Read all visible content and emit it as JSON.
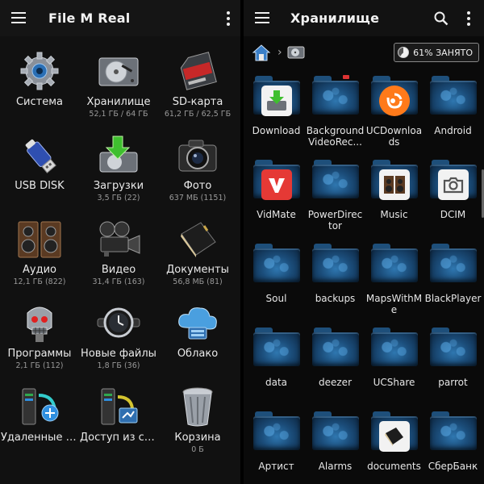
{
  "left": {
    "title": "File M Real",
    "items": [
      {
        "label": "Система",
        "sub": "",
        "icon": "gear-icon"
      },
      {
        "label": "Хранилище",
        "sub": "52,1 ГБ / 64 ГБ",
        "icon": "hard-drive-icon"
      },
      {
        "label": "SD-карта",
        "sub": "61,2 ГБ / 62,5 ГБ",
        "icon": "sd-card-icon"
      },
      {
        "label": "USB DISK",
        "sub": "",
        "icon": "usb-icon"
      },
      {
        "label": "Загрузки",
        "sub": "3,5 ГБ (22)",
        "icon": "download-icon"
      },
      {
        "label": "Фото",
        "sub": "637 МБ (1151)",
        "icon": "camera-icon"
      },
      {
        "label": "Аудио",
        "sub": "12,1 ГБ (822)",
        "icon": "speaker-icon"
      },
      {
        "label": "Видео",
        "sub": "31,4 ГБ (163)",
        "icon": "video-camera-icon"
      },
      {
        "label": "Документы",
        "sub": "56,8 МБ (81)",
        "icon": "book-icon"
      },
      {
        "label": "Программы",
        "sub": "2,1 ГБ (112)",
        "icon": "robot-skull-icon"
      },
      {
        "label": "Новые файлы",
        "sub": "1,8 ГБ (36)",
        "icon": "watch-icon"
      },
      {
        "label": "Облако",
        "sub": "",
        "icon": "cloud-icon"
      },
      {
        "label": "Удаленные хранилища",
        "sub": "",
        "icon": "server-icon"
      },
      {
        "label": "Доступ из сети",
        "sub": "",
        "icon": "network-server-icon"
      },
      {
        "label": "Корзина",
        "sub": "0 Б",
        "icon": "trash-icon"
      }
    ]
  },
  "right": {
    "title": "Хранилище",
    "usage": "61% ЗАНЯТО",
    "folders": [
      {
        "label": "Download",
        "badge": "download-icon"
      },
      {
        "label": "BackgroundVideoRec...",
        "badge": ""
      },
      {
        "label": "UCDownloads",
        "badge": "uc-browser-icon"
      },
      {
        "label": "Android",
        "badge": ""
      },
      {
        "label": "VidMate",
        "badge": "vidmate-icon"
      },
      {
        "label": "PowerDirector",
        "badge": ""
      },
      {
        "label": "Music",
        "badge": "speaker-icon"
      },
      {
        "label": "DCIM",
        "badge": "camera-icon"
      },
      {
        "label": "Soul",
        "badge": ""
      },
      {
        "label": "backups",
        "badge": ""
      },
      {
        "label": "MapsWithMe",
        "badge": ""
      },
      {
        "label": "BlackPlayer",
        "badge": ""
      },
      {
        "label": "data",
        "badge": ""
      },
      {
        "label": "deezer",
        "badge": ""
      },
      {
        "label": "UCShare",
        "badge": ""
      },
      {
        "label": "parrot",
        "badge": ""
      },
      {
        "label": "Артист",
        "badge": ""
      },
      {
        "label": "Alarms",
        "badge": ""
      },
      {
        "label": "documents",
        "badge": "book-icon"
      },
      {
        "label": "СберБанк",
        "badge": ""
      }
    ]
  }
}
